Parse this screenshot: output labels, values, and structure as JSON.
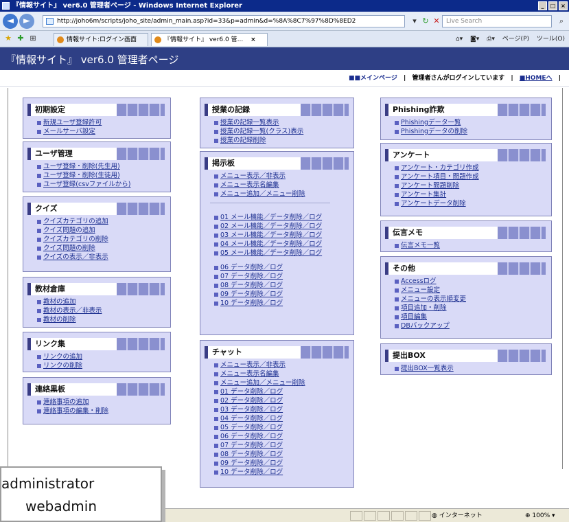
{
  "browser": {
    "window_title": "『情報サイト』 ver6.0 管理者ページ - Windows Internet Explorer",
    "url": "http://joho6m/scripts/joho_site/admin_main.asp?id=33&p=admin&d=%8A%8C7%97%8D%8ED2",
    "search_placeholder": "Live Search",
    "tabs": [
      {
        "label": "情報サイト:ログイン画面",
        "active": false
      },
      {
        "label": "『情報サイト』 ver6.0 管...",
        "active": true
      }
    ],
    "tools": {
      "page": "ページ(P)",
      "tools": "ツール(O)"
    },
    "status_zone": "インターネット",
    "zoom": "100%"
  },
  "header": {
    "title": "『情報サイト』 ver6.0 管理者ページ"
  },
  "subheader": {
    "main_link": "■■メインページ",
    "logged_in": "管理者さんがログインしています",
    "home_link": "■HOMEへ"
  },
  "panels": {
    "shoki": {
      "title": "初期設定",
      "items": [
        "新規ユーザ登録許可",
        "メールサーバ設定"
      ]
    },
    "user": {
      "title": "ユーザ管理",
      "items": [
        "ユーザ登録・削除(先生用)",
        "ユーザ登録・削除(生徒用)",
        "ユーザ登録(csvファイルから)"
      ]
    },
    "quiz": {
      "title": "クイズ",
      "items": [
        "クイズカテゴリの追加",
        "クイズ問題の追加",
        "クイズカテゴリの削除",
        "クイズ問題の削除",
        "クイズの表示／非表示"
      ]
    },
    "kyozai": {
      "title": "教材倉庫",
      "items": [
        "教材の追加",
        "教材の表示／非表示",
        "教材の削除"
      ]
    },
    "link": {
      "title": "リンク集",
      "items": [
        "リンクの追加",
        "リンクの削除"
      ]
    },
    "renraku": {
      "title": "連絡黒板",
      "items": [
        "連絡事項の追加",
        "連絡事項の編集・削除"
      ]
    },
    "jugyo": {
      "title": "授業の記録",
      "items": [
        "授業の記録一覧表示",
        "授業の記録一覧(クラス)表示",
        "授業の記録削除"
      ]
    },
    "keiji": {
      "title": "掲示板",
      "menu": [
        "メニュー表示／非表示",
        "メニュー表示名編集",
        "メニュー追加／メニュー削除"
      ],
      "mail": [
        "01 メール機能／データ削除／ログ",
        "02 メール機能／データ削除／ログ",
        "03 メール機能／データ削除／ログ",
        "04 メール機能／データ削除／ログ",
        "05 メール機能／データ削除／ログ"
      ],
      "data": [
        "06 データ削除／ログ",
        "07 データ削除／ログ",
        "08 データ削除／ログ",
        "09 データ削除／ログ",
        "10 データ削除／ログ"
      ]
    },
    "chat": {
      "title": "チャット",
      "items": [
        "メニュー表示／非表示",
        "メニュー表示名編集",
        "メニュー追加／メニュー削除",
        "01 データ削除／ログ",
        "02 データ削除／ログ",
        "03 データ削除／ログ",
        "04 データ削除／ログ",
        "05 データ削除／ログ",
        "06 データ削除／ログ",
        "07 データ削除／ログ",
        "08 データ削除／ログ",
        "09 データ削除／ログ",
        "10 データ削除／ログ"
      ]
    },
    "phishing": {
      "title": "Phishing詐欺",
      "items": [
        "Phishingデータ一覧",
        "Phishingデータの削除"
      ]
    },
    "enquete": {
      "title": "アンケート",
      "items": [
        "アンケート・カテゴリ作成",
        "アンケート項目・問題作成",
        "アンケート問題削除",
        "アンケート集計",
        "アンケートデータ削除"
      ]
    },
    "dengon": {
      "title": "伝言メモ",
      "items": [
        "伝言メモ一覧"
      ]
    },
    "sonota": {
      "title": "その他",
      "items": [
        "Accessログ",
        "メニュー設定",
        "メニューの表示順変更",
        "項目追加・削除",
        "項目編集",
        "DBバックアップ"
      ]
    },
    "teishutsu": {
      "title": "提出BOX",
      "items": [
        "提出BOX一覧表示"
      ]
    }
  },
  "caption": {
    "line1": "administrator",
    "line2": "webadmin"
  }
}
